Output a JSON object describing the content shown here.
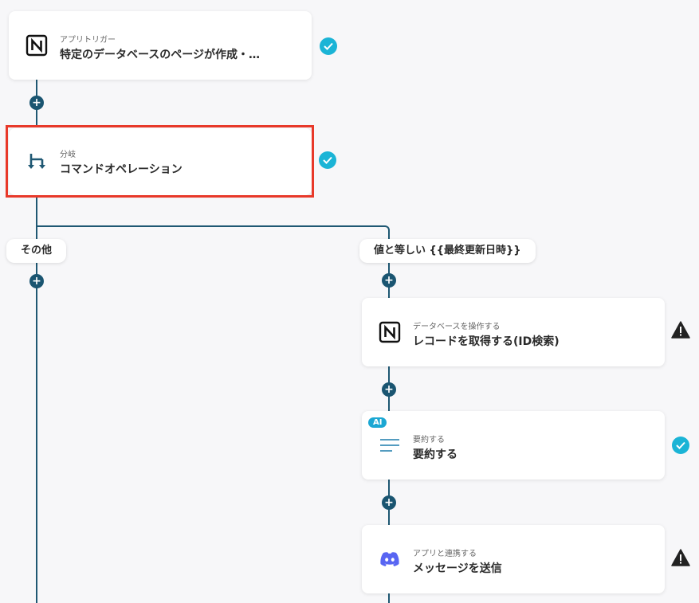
{
  "colors": {
    "line": "#1f5873",
    "check": "#1bb4d6",
    "highlight": "#e8392a",
    "ai_badge": "#1ba7d3",
    "discord": "#5865f2"
  },
  "steps": [
    {
      "subtitle": "アプリトリガー",
      "title": "特定のデータベースのページが作成・…",
      "icon": "notion-icon",
      "status": "check"
    },
    {
      "subtitle": "分岐",
      "title": "コマンドオペレーション",
      "icon": "branch-icon",
      "status": "check"
    },
    {
      "subtitle": "データベースを操作する",
      "title": "レコードを取得する(ID検索)",
      "icon": "notion-icon",
      "status": "warning"
    },
    {
      "subtitle": "要約する",
      "title": "要約する",
      "icon": "summarize-icon",
      "status": "check",
      "badge": "AI"
    },
    {
      "subtitle": "アプリと連携する",
      "title": "メッセージを送信",
      "icon": "discord-icon",
      "status": "warning"
    }
  ],
  "branches": {
    "other": "その他",
    "equals": "値と等しい {{最終更新日時}}"
  },
  "plus_symbol": "+"
}
